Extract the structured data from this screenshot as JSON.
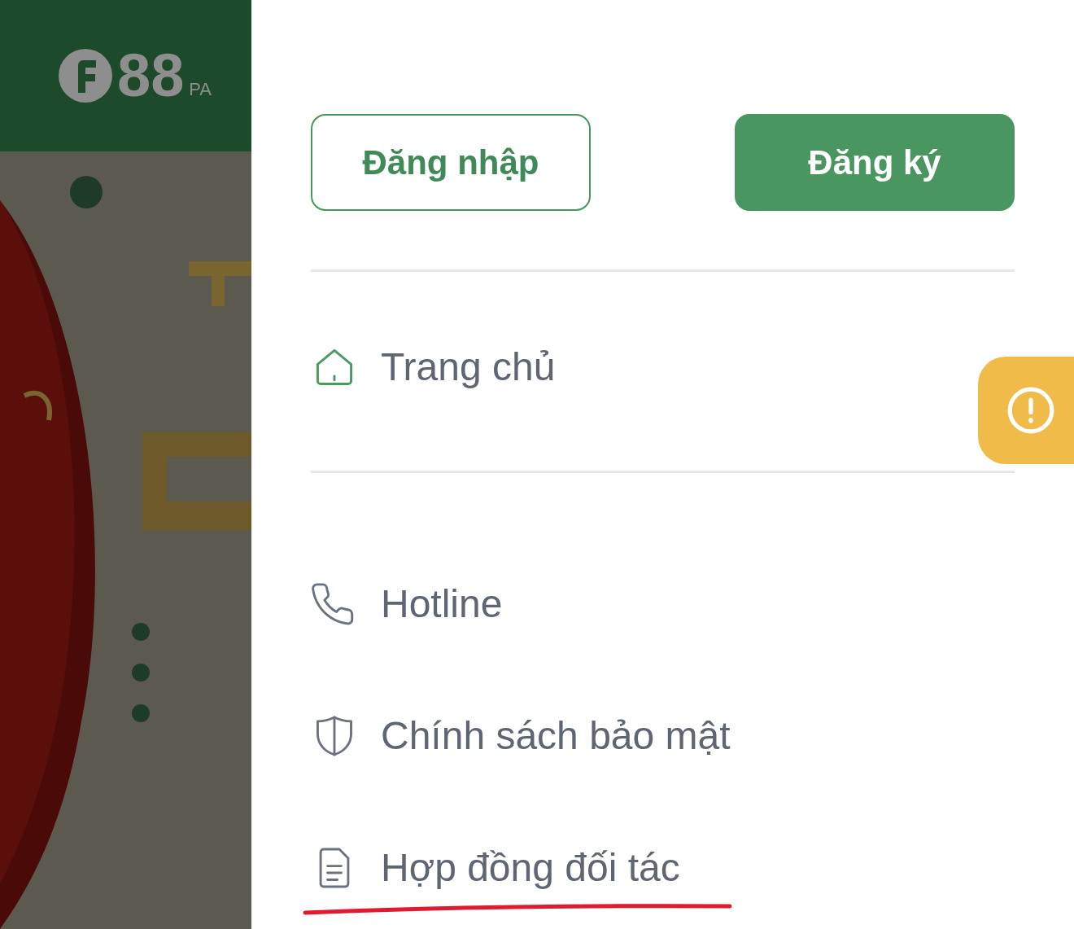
{
  "background_page": {
    "logo": {
      "text": "88",
      "suffix": "PA"
    }
  },
  "drawer": {
    "buttons": [
      {
        "label": "Đăng nhập",
        "kind": "outline"
      },
      {
        "label": "Đăng ký",
        "kind": "filled"
      }
    ],
    "home_item": {
      "label": "Trang chủ",
      "kind": "home"
    },
    "menu_items": [
      {
        "label": "Hotline",
        "kind": "phone"
      },
      {
        "label": "Chính sách bảo mật",
        "kind": "shield"
      },
      {
        "label": "Hợp đồng đối tác",
        "kind": "document"
      }
    ]
  },
  "alert_tab": {
    "kind": "alert"
  }
}
